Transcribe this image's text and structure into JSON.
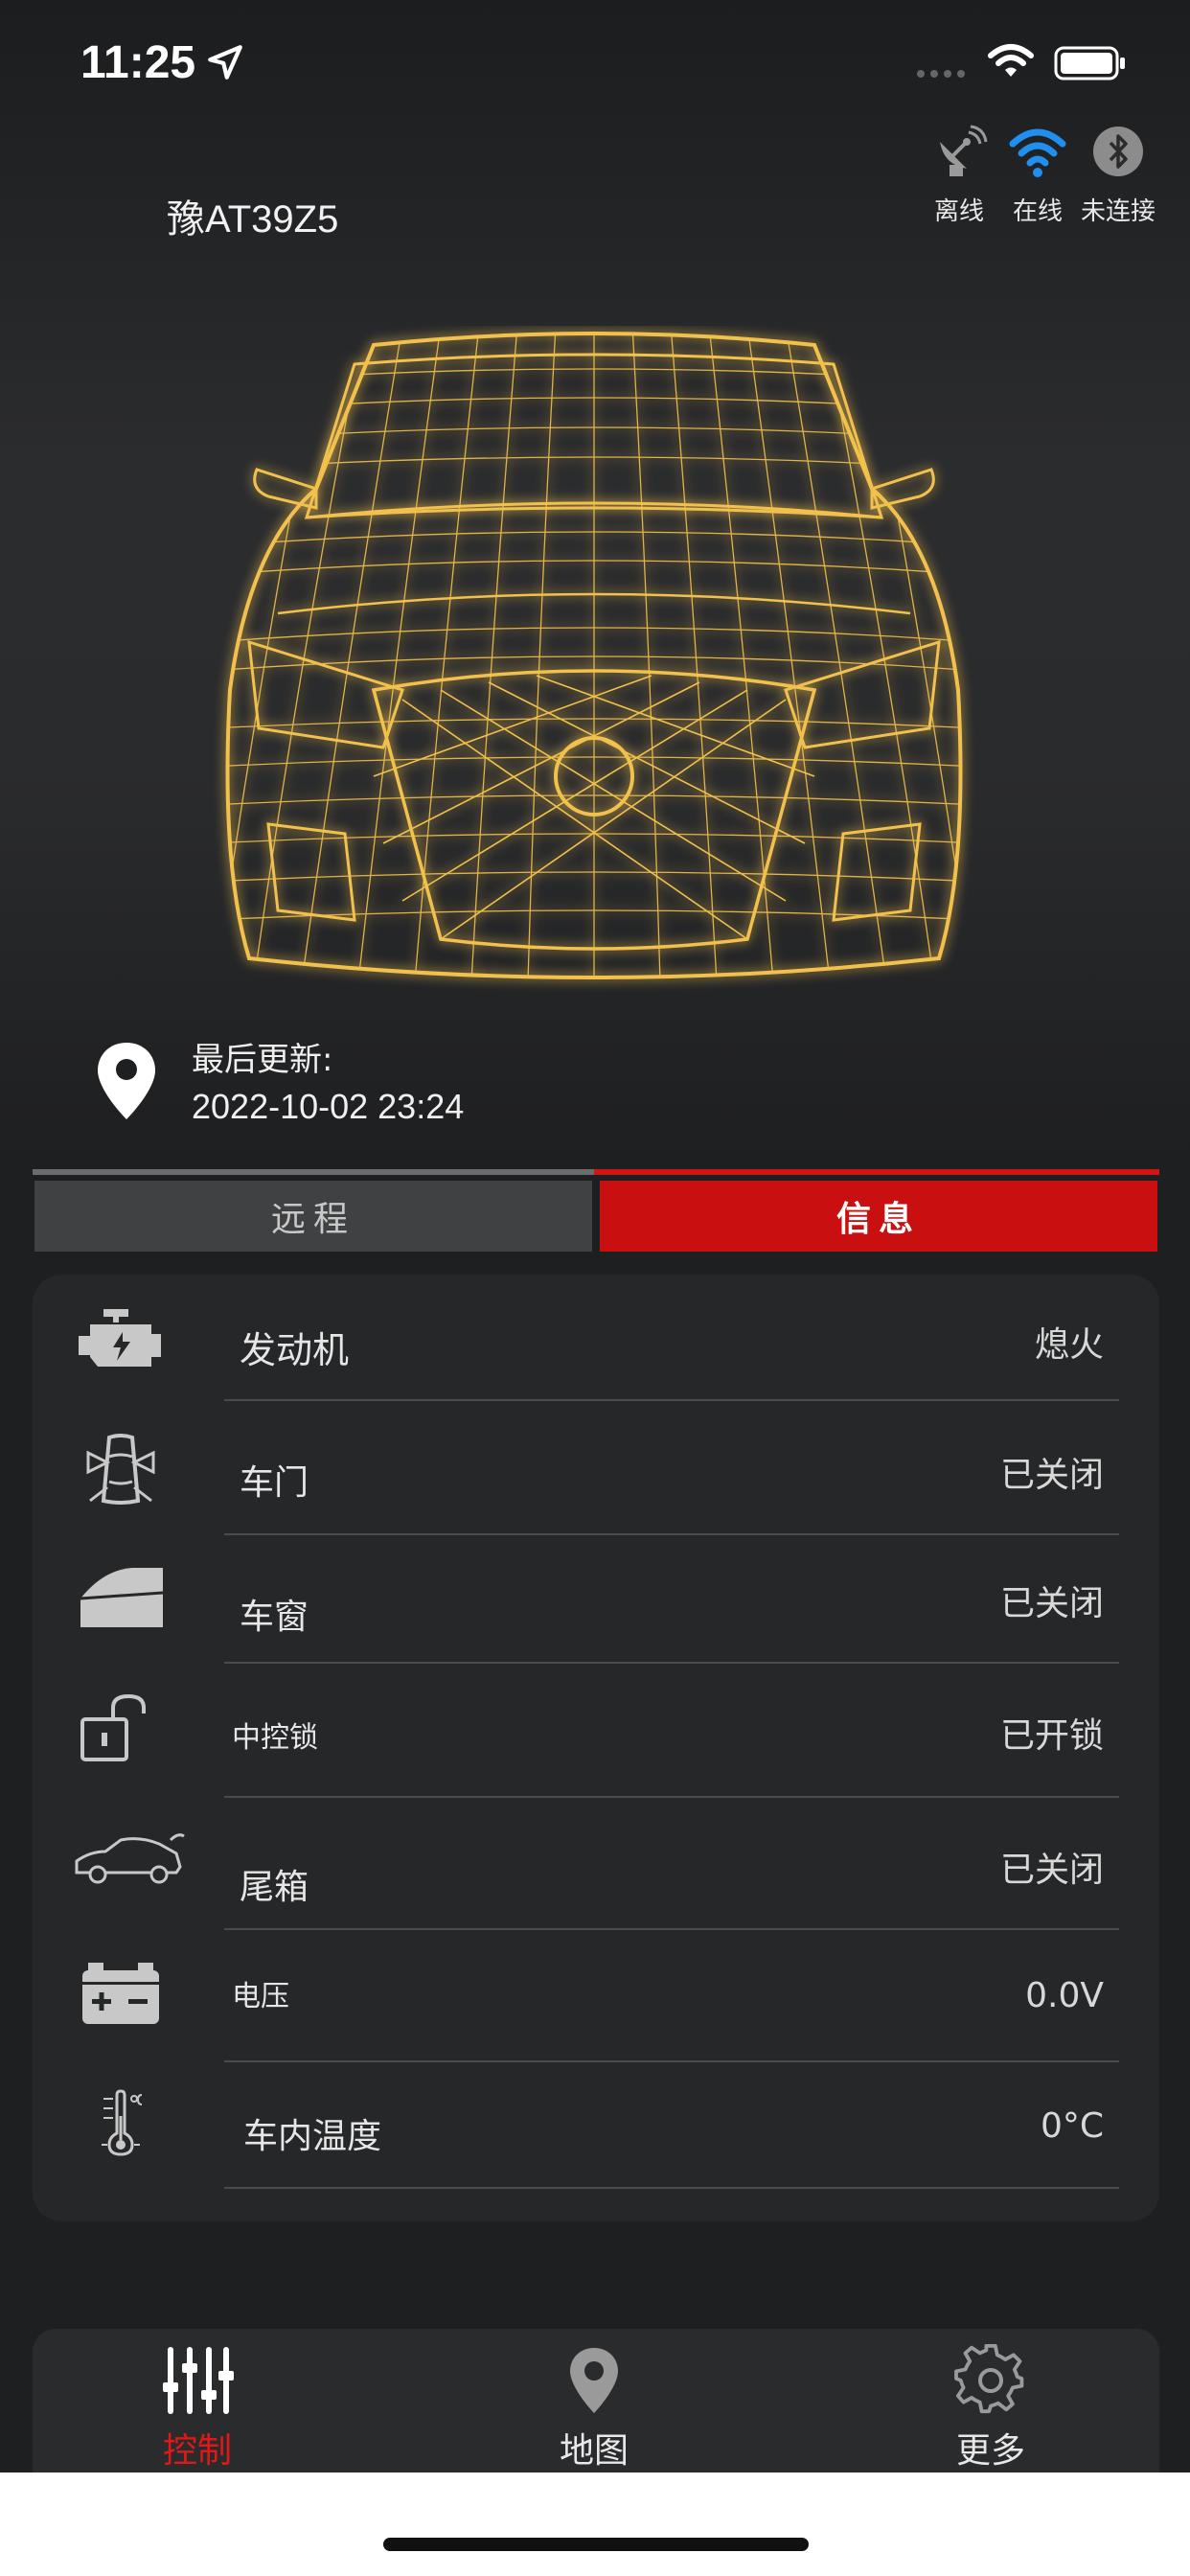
{
  "status_bar": {
    "time": "11:25"
  },
  "header": {
    "plate": "豫AT39Z5",
    "connections": [
      {
        "icon": "satellite-icon",
        "label": "离线",
        "color": "#9a9a9a"
      },
      {
        "icon": "wifi-icon",
        "label": "在线",
        "color": "#1f8ff0"
      },
      {
        "icon": "bluetooth-icon",
        "label": "未连接",
        "color": "#9a9a9a"
      }
    ]
  },
  "last_update": {
    "label": "最后更新:",
    "time": "2022-10-02 23:24"
  },
  "tabs": [
    {
      "label": "远程",
      "active": false
    },
    {
      "label": "信息",
      "active": true
    }
  ],
  "info_rows": [
    {
      "icon": "engine-icon",
      "label": "发动机",
      "value": "熄火"
    },
    {
      "icon": "car-door-icon",
      "label": "车门",
      "value": "已关闭"
    },
    {
      "icon": "car-window-icon",
      "label": "车窗",
      "value": "已关闭"
    },
    {
      "icon": "unlocked-padlock-icon",
      "label": "中控锁",
      "value": "已开锁"
    },
    {
      "icon": "car-trunk-icon",
      "label": "尾箱",
      "value": "已关闭"
    },
    {
      "icon": "battery-icon",
      "label": "电压",
      "value": "0.0V"
    },
    {
      "icon": "thermometer-icon",
      "label": "车内温度",
      "value": "0°C"
    }
  ],
  "nav": [
    {
      "icon": "sliders-icon",
      "label": "控制",
      "active": true
    },
    {
      "icon": "map-pin-icon",
      "label": "地图",
      "active": false
    },
    {
      "icon": "gear-icon",
      "label": "更多",
      "active": false
    }
  ],
  "colors": {
    "accent": "#d11414",
    "active_nav": "#e01818",
    "car_wireframe": "#f2c14e",
    "online_blue": "#1f8ff0"
  }
}
